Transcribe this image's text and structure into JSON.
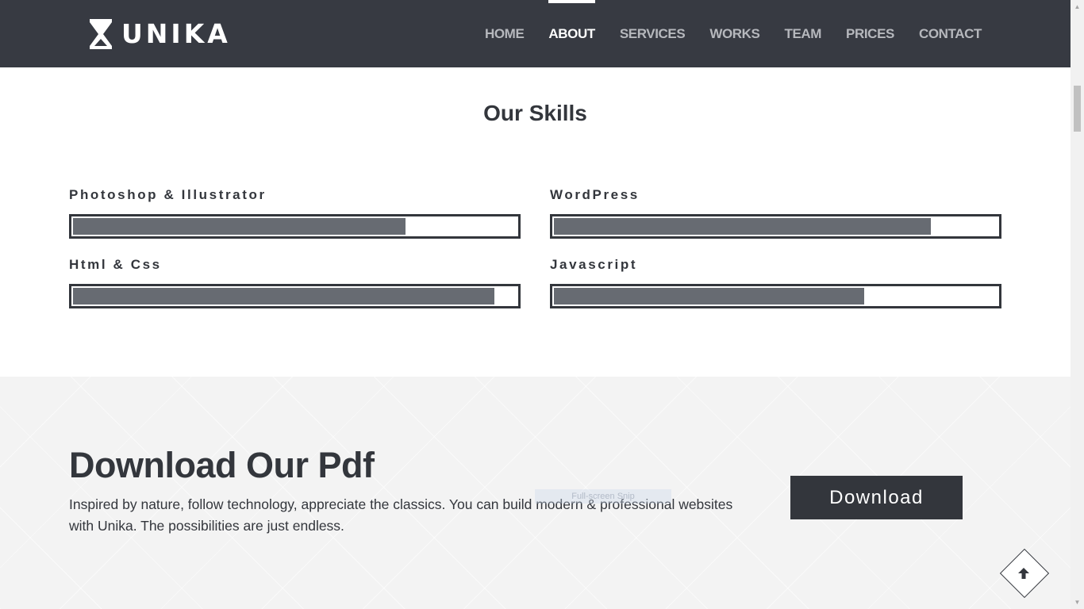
{
  "header": {
    "logo_text": "UNIKA",
    "nav": [
      {
        "label": "HOME",
        "active": false
      },
      {
        "label": "ABOUT",
        "active": true
      },
      {
        "label": "SERVICES",
        "active": false
      },
      {
        "label": "WORKS",
        "active": false
      },
      {
        "label": "TEAM",
        "active": false
      },
      {
        "label": "PRICES",
        "active": false
      },
      {
        "label": "CONTACT",
        "active": false
      }
    ]
  },
  "skills": {
    "title": "Our Skills",
    "items": [
      {
        "label": "Photoshop & Illustrator",
        "percent": 75
      },
      {
        "label": "WordPress",
        "percent": 85
      },
      {
        "label": "Html & Css",
        "percent": 95
      },
      {
        "label": "Javascript",
        "percent": 70
      }
    ]
  },
  "download": {
    "title": "Download Our Pdf",
    "text": "Inspired by nature, follow technology, appreciate the classics. You can build modern & professional websites with Unika. The possibilities are just endless.",
    "ghost_label": "Full-screen Snip",
    "button_label": "Download"
  },
  "icons": {
    "back_to_top": "arrow-up-icon",
    "logo_mark": "hourglass-icon"
  },
  "colors": {
    "header_bg": "#373a42",
    "nav_inactive": "#b6b8bd",
    "nav_active": "#ffffff",
    "text_dark": "#33363c",
    "bar_fill": "#676b72",
    "section_bg": "#f3f3f3",
    "button_bg": "#33363c"
  }
}
